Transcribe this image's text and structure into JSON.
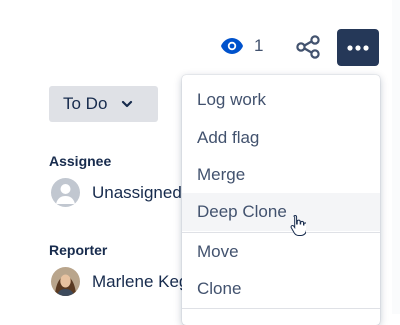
{
  "header": {
    "watch_count": "1",
    "watch_icon": "eye-icon",
    "share_icon": "share-icon",
    "more_icon": "ellipsis-icon",
    "more_button_color": "#253858"
  },
  "status": {
    "label": "To Do",
    "icon": "chevron-down-icon"
  },
  "fields": {
    "assignee": {
      "label": "Assignee",
      "value": "Unassigned"
    },
    "reporter": {
      "label": "Reporter",
      "value": "Marlene Keg"
    }
  },
  "menu": {
    "items": [
      {
        "label": "Log work"
      },
      {
        "label": "Add flag"
      },
      {
        "label": "Merge"
      },
      {
        "label": "Deep Clone"
      },
      {
        "label": "Move"
      },
      {
        "label": "Clone"
      }
    ]
  }
}
